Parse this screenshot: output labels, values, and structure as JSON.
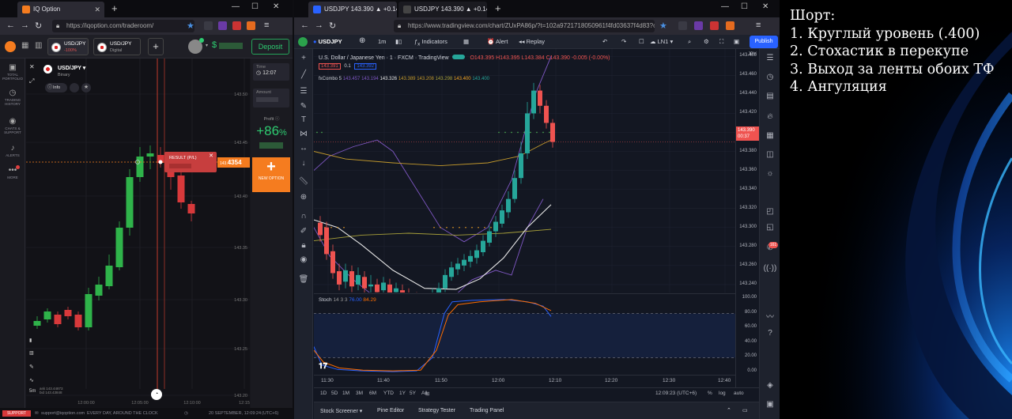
{
  "iq_browser": {
    "tab_title": "IQ Option",
    "url": "https://iqoption.com/traderoom/",
    "asset_tabs": [
      {
        "name": "USD/JPY",
        "sub": "-100%"
      },
      {
        "name": "USD/JPY",
        "sub": "Digital"
      }
    ],
    "deposit_label": "Deposit",
    "balance_prefix": "$",
    "sidebar": [
      {
        "label": "TOTAL PORTFOLIO",
        "icon": "briefcase-icon"
      },
      {
        "label": "TRADING HISTORY",
        "icon": "clock-icon"
      },
      {
        "label": "CHATS & SUPPORT",
        "icon": "chat-icon"
      },
      {
        "label": "ALERTS",
        "icon": "bell-icon"
      },
      {
        "label": "MORE",
        "icon": "dots-icon"
      }
    ],
    "asset": {
      "name": "USD/JPY",
      "type": "Binary",
      "info_label": "Info"
    },
    "right_panel": {
      "time_label": "Time",
      "time_value": "12:07",
      "amount_label": "Amount",
      "profit_label": "Profit",
      "profit_percent": "+86",
      "profit_unit": "%",
      "new_option_label": "NEW OPTION"
    },
    "result_label": "RESULT (P/L)",
    "current_price_suffix": "4354",
    "current_price_prefix": "143.",
    "price_labels": [
      "143.50",
      "143.45",
      "143.40",
      "143.35",
      "143.30",
      "143.25",
      "143.20"
    ],
    "time_labels": [
      "12:00:00",
      "12:05:00",
      "12:10:00",
      "12:15"
    ],
    "left_tools": [
      "1m",
      "5m"
    ],
    "footer": {
      "support": "SUPPORT",
      "email": "support@iqoption.com",
      "slogan": "EVERY DAY, AROUND THE CLOCK",
      "datetime": "20 SEPTEMBER, 12:09:24",
      "tz": "(UTC+6)"
    },
    "bid_ask": [
      "ask 143.44873",
      "bid 143.43848"
    ]
  },
  "tv_browser": {
    "tabs": [
      {
        "title": "USDJPY 143.390 ▲ +0.14% LN1"
      },
      {
        "title": "USDJPY 143.390 ▲ +0.14% LN1"
      }
    ],
    "url": "https://www.tradingview.com/chart/ZUxPA86p/?t=102a9721718050961f4fd03637f4d83?offer...",
    "toolbar": {
      "symbol": "USDJPY",
      "interval": "1m",
      "indicators": "Indicators",
      "alert": "Alert",
      "replay": "Replay",
      "layout": "LN1",
      "publish": "Publish"
    },
    "legend": {
      "title": "U.S. Dollar / Japanese Yen",
      "interval": "1",
      "source": "FXCM",
      "platform": "TradingView",
      "ohlc": "O143.395 H143.395 L143.384 C143.390 -0.005 (-0.00%)",
      "bid": "143.391",
      "spread": "0.1",
      "ask": "143.392",
      "indicator": "fxCombo 5",
      "indicator_values": [
        "143.457",
        "143.194",
        "143.326",
        "143.389",
        "143.208",
        "143.298",
        "143.400",
        "143.400"
      ]
    },
    "currency": "JPY",
    "price_labels": [
      "143.480",
      "143.460",
      "143.440",
      "143.420",
      "143.400",
      "143.380",
      "143.360",
      "143.340",
      "143.320",
      "143.300",
      "143.280",
      "143.260",
      "143.240"
    ],
    "current_price": "143.390",
    "countdown": "00:37",
    "stoch": {
      "label": "Stoch",
      "params": "14 3 3",
      "k": "76.00",
      "d": "84.29",
      "levels": [
        "100.00",
        "80.00",
        "60.00",
        "40.00",
        "20.00",
        "0.00"
      ]
    },
    "time_labels": [
      "11:30",
      "11:40",
      "11:50",
      "12:00",
      "12:10",
      "12:20",
      "12:30",
      "12:40"
    ],
    "ranges": [
      "1D",
      "5D",
      "1M",
      "3M",
      "6M",
      "YTD",
      "1Y",
      "5Y",
      "All"
    ],
    "clock": "12:09:23 (UTC+6)",
    "scale_opts": [
      "%",
      "log",
      "auto"
    ],
    "bottom_tabs": [
      "Stock Screener",
      "Pine Editor",
      "Strategy Tester",
      "Trading Panel"
    ],
    "notification_badge": "161"
  },
  "notes": {
    "lines": [
      "Шорт:",
      "1. Круглый уровень (.400)",
      "2. Стохастик в перекупе",
      "3. Выход за ленты обоих ТФ",
      "4. Ангуляция"
    ]
  },
  "colors": {
    "bull": "#26a69a",
    "bear": "#ef5350",
    "iq_bull": "#2fb34a",
    "iq_bear": "#d8393b",
    "iq_orange": "#f57c1f",
    "tv_blue": "#2962ff"
  }
}
